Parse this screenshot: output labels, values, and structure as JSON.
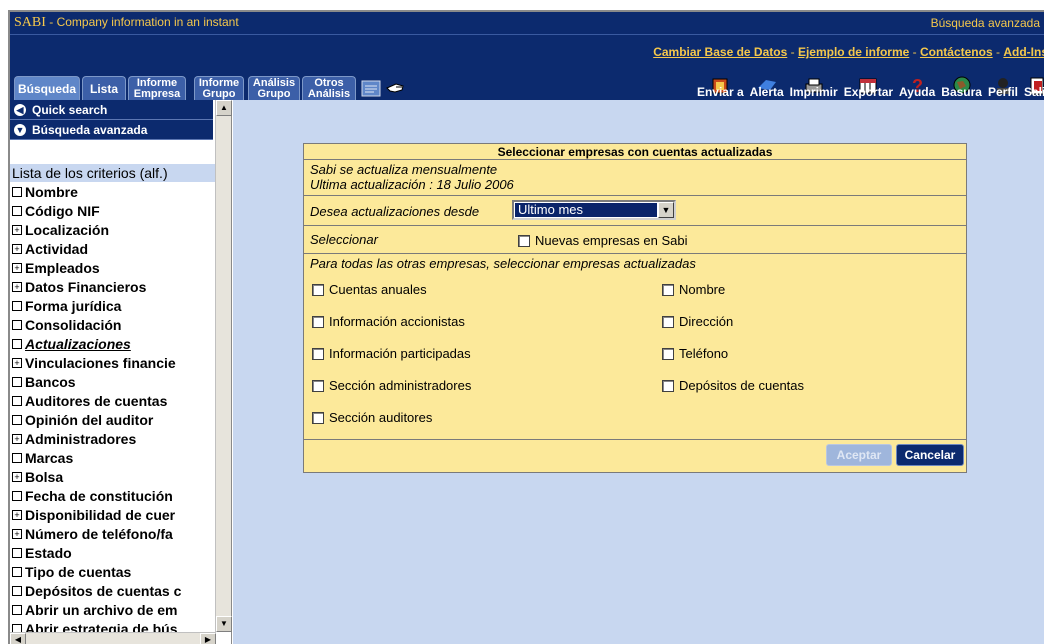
{
  "titlebar": {
    "brand": "SABI",
    "subtitle": " - Company information in an instant",
    "right": "Búsqueda avanzada"
  },
  "links": [
    {
      "label": "Cambiar Base de Datos"
    },
    {
      "label": "Ejemplo de informe"
    },
    {
      "label": "Contáctenos"
    },
    {
      "label": "Add-Ins"
    }
  ],
  "link_separator": " - ",
  "tabs": {
    "busqueda": "Búsqueda",
    "lista": "Lista",
    "informe_empresa_1": "Informe",
    "informe_empresa_2": "Empresa",
    "informe_grupo_1": "Informe",
    "informe_grupo_2": "Grupo",
    "analisis_grupo_1": "Análisis",
    "analisis_grupo_2": "Grupo",
    "otros_analisis_1": "Otros",
    "otros_analisis_2": "Análisis"
  },
  "actions": {
    "enviar": "Enviar a",
    "alerta": "Alerta",
    "imprimir": "Imprimir",
    "exportar": "Exportar",
    "ayuda": "Ayuda",
    "basura": "Basura",
    "perfil": "Perfil",
    "salir": "Salir"
  },
  "sidebar": {
    "quick_search": "Quick search",
    "busqueda_avanzada": "Búsqueda avanzada",
    "criteria_header": "Lista de los criterios (alf.)",
    "criteria": [
      {
        "label": "Nombre",
        "expand": false
      },
      {
        "label": "Código NIF",
        "expand": false
      },
      {
        "label": "Localización",
        "expand": true
      },
      {
        "label": "Actividad",
        "expand": true
      },
      {
        "label": "Empleados",
        "expand": true
      },
      {
        "label": "Datos Financieros",
        "expand": true
      },
      {
        "label": "Forma jurídica",
        "expand": false
      },
      {
        "label": "Consolidación",
        "expand": false
      },
      {
        "label": "Actualizaciones",
        "expand": false,
        "active": true
      },
      {
        "label": "Vinculaciones financie",
        "expand": true
      },
      {
        "label": "Bancos",
        "expand": false
      },
      {
        "label": "Auditores de cuentas",
        "expand": false
      },
      {
        "label": "Opinión del auditor",
        "expand": false
      },
      {
        "label": "Administradores",
        "expand": true
      },
      {
        "label": "Marcas",
        "expand": false
      },
      {
        "label": "Bolsa",
        "expand": true
      },
      {
        "label": "Fecha de constitución",
        "expand": false
      },
      {
        "label": "Disponibilidad de cuer",
        "expand": true
      },
      {
        "label": "Número de teléfono/fa",
        "expand": true
      },
      {
        "label": "Estado",
        "expand": false
      },
      {
        "label": "Tipo de cuentas",
        "expand": false
      },
      {
        "label": "Depósitos de cuentas c",
        "expand": false
      },
      {
        "label": "Abrir un archivo de em",
        "expand": false
      },
      {
        "label": "Abrir estrategia de bús",
        "expand": false
      }
    ]
  },
  "dialog": {
    "title": "Seleccionar empresas con cuentas actualizadas",
    "info_line1": "Sabi se actualiza mensualmente",
    "info_line2": "Ultima actualización : 18 Julio 2006",
    "desde_label": "Desea actualizaciones desde",
    "desde_value": "Ultimo mes",
    "seleccionar_label": "Seleccionar",
    "nuevas_label": "Nuevas empresas en Sabi",
    "otras_label": "Para todas las otras empresas, seleccionar empresas actualizadas",
    "checks_left": [
      "Cuentas anuales",
      "Información accionistas",
      "Información participadas",
      "Sección administradores",
      "Sección auditores"
    ],
    "checks_right": [
      "Nombre",
      "Dirección",
      "Teléfono",
      "Depósitos de cuentas"
    ],
    "accept": "Aceptar",
    "cancel": "Cancelar"
  },
  "colors": {
    "navy": "#0c2a6e",
    "gold": "#f5c84c",
    "panel": "#c8d7f0",
    "dialog": "#fce99a"
  }
}
